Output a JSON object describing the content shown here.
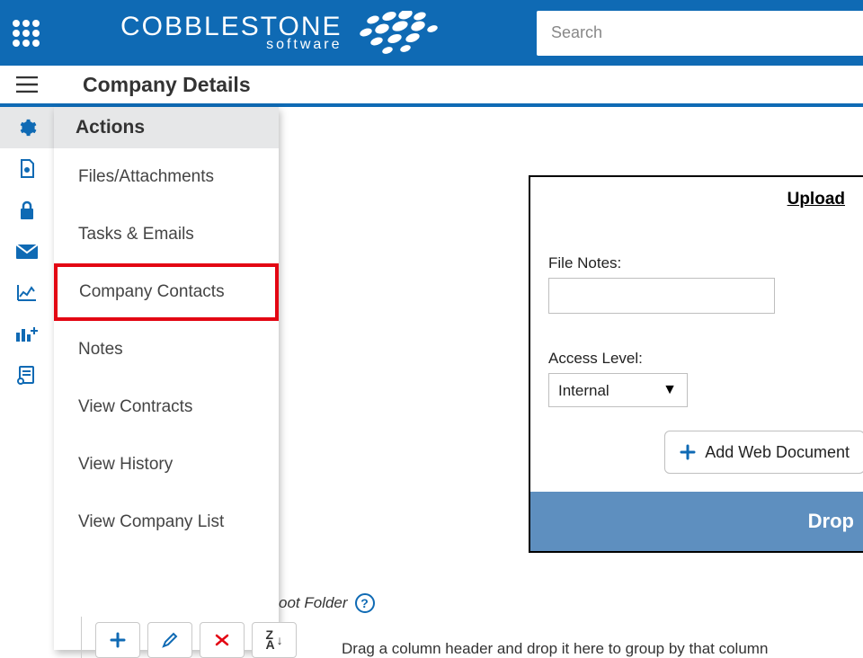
{
  "header": {
    "brand_line1": "COBBLESTONE",
    "brand_line2": "software",
    "search_placeholder": "Search"
  },
  "page": {
    "title": "Company Details"
  },
  "flyout": {
    "header": "Actions",
    "items": [
      {
        "label": "Files/Attachments",
        "highlighted": false
      },
      {
        "label": "Tasks & Emails",
        "highlighted": false
      },
      {
        "label": "Company Contacts",
        "highlighted": true
      },
      {
        "label": "Notes",
        "highlighted": false
      },
      {
        "label": "View Contracts",
        "highlighted": false
      },
      {
        "label": "View History",
        "highlighted": false
      },
      {
        "label": "View Company List",
        "highlighted": false
      }
    ]
  },
  "rail": {
    "icons": [
      "gear",
      "doc-gear",
      "lock",
      "mail",
      "chart-line",
      "chart-plus",
      "form-gear"
    ]
  },
  "upload": {
    "title": "Upload",
    "file_notes_label": "File Notes:",
    "file_notes_value": "",
    "access_level_label": "Access Level:",
    "access_level_value": "Internal",
    "add_web_doc_label": "Add Web Document",
    "dropzone_label": "Drop"
  },
  "bottom": {
    "root_folder_text": "oot Folder",
    "drag_hint": "Drag a column header and drop it here to group by that column"
  }
}
